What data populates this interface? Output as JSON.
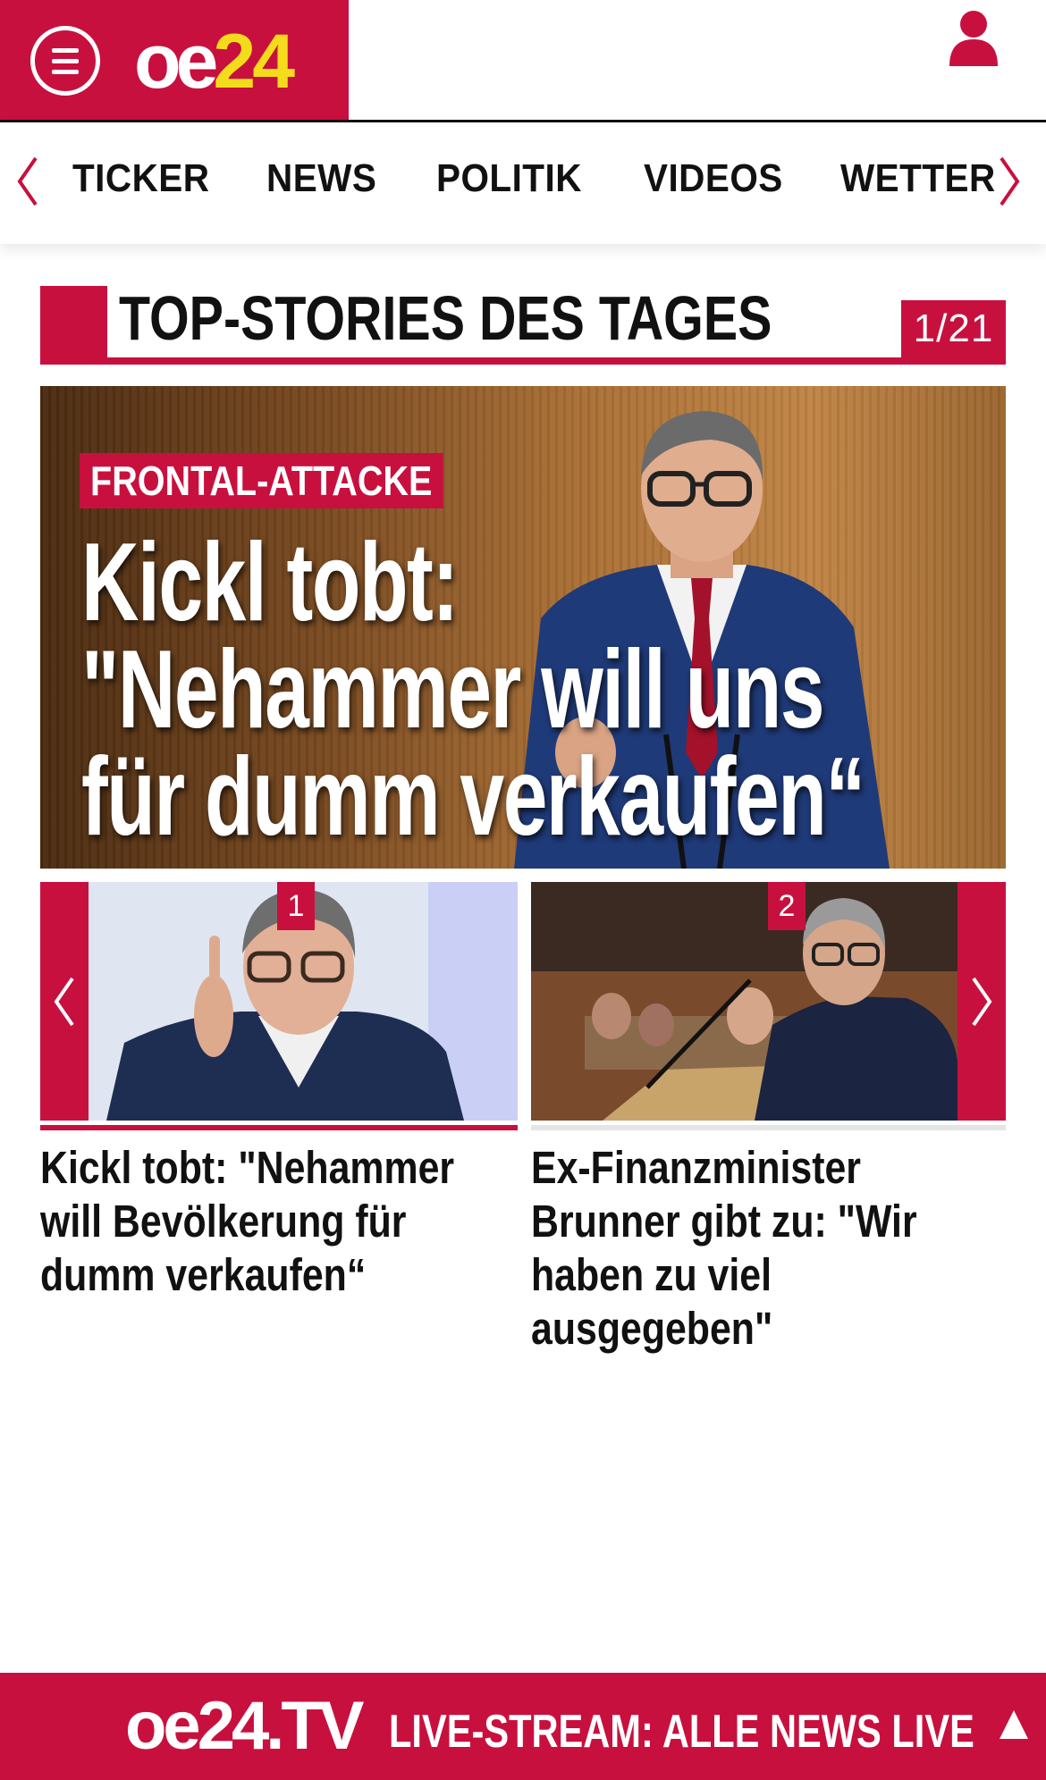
{
  "header": {
    "logo_oe": "oe",
    "logo_24": "24",
    "menu_icon": "hamburger-menu-icon",
    "user_icon": "user-icon"
  },
  "nav": {
    "items": [
      "TICKER",
      "NEWS",
      "POLITIK",
      "VIDEOS",
      "WETTER"
    ],
    "prev_icon": "chevron-left-icon",
    "next_icon": "chevron-right-icon"
  },
  "section": {
    "title": "TOP-STORIES DES TAGES",
    "counter": "1/21"
  },
  "hero": {
    "kicker": "FRONTAL-ATTACKE",
    "title_lines": [
      "Kickl tobt:",
      "\"Nehammer will uns",
      "für dumm verkaufen“"
    ]
  },
  "cards": [
    {
      "number": "1",
      "title": "Kickl tobt: \"Nehammer will Bevölkerung für dumm verkaufen“"
    },
    {
      "number": "2",
      "title": "Ex-Finanzminister Brunner gibt zu: \"Wir haben zu viel ausgegeben\""
    }
  ],
  "live_bar": {
    "logo": "oe24.TV",
    "text": "LIVE-STREAM:  ALLE NEWS LIVE",
    "up_icon": "arrow-up-icon"
  },
  "colors": {
    "brand_red": "#c8103e",
    "logo_yellow": "#f4dc1c"
  }
}
